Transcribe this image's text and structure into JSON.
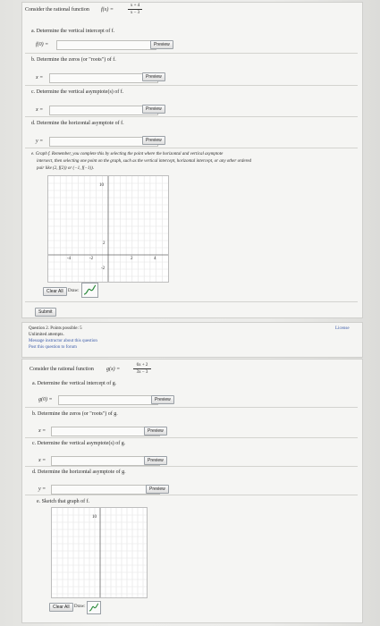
{
  "q1": {
    "intro": "Consider the rational function",
    "func_lhs": "f(x) =",
    "func_num": "x + 4",
    "func_den": "x − 3",
    "a": "a. Determine the vertical intercept of f.",
    "a_label": "f(0) =",
    "b": "b. Determine the zeros (or \"roots\") of f.",
    "b_label": "x =",
    "c": "c. Determine the vertical asymptote(s) of f.",
    "c_label": "x =",
    "d": "d. Determine the horizontal asymptote of f.",
    "d_label": "y =",
    "preview": "Preview",
    "e_line1": "e. Graph f. Remember, you complete this by selecting the point where the horizontal and vertical asymptote",
    "e_line2": "intersect, then selecting one point on the graph, such as the vertical intercept, horizontal intercept, or any other ordered",
    "e_line3": "pair like (2, f(2)) or (−1, f(−1)).",
    "ticks_x": [
      "-4",
      "-2",
      "2",
      "4"
    ],
    "ticks_y": [
      "10",
      "2",
      "-2"
    ],
    "clear_all": "Clear All",
    "draw": "Draw:",
    "submit": "Submit"
  },
  "q2": {
    "header": "Question 2. Points possible: 5",
    "attempts": "Unlimited attempts.",
    "message": "Message instructor about this question",
    "post": "Post this question to forum",
    "license": "License",
    "intro": "Consider the rational function",
    "func_lhs": "g(x) =",
    "func_num": "6x + 2",
    "func_den": "3x − 3",
    "a": "a. Determine the vertical intercept of g.",
    "a_label": "g(0) =",
    "b": "b. Determine the zeros (or \"roots\") of g.",
    "b_label": "x =",
    "c": "c. Determine the vertical asymptote(s) of g.",
    "c_label": "x =",
    "d": "d. Determine the horizontal asymptote of g.",
    "d_label": "y =",
    "preview": "Preview",
    "e": "e. Sketch that graph of f.",
    "ticks_y": [
      "10"
    ],
    "clear_all": "Clear All",
    "draw": "Draw:"
  },
  "colors": {
    "link_blue": "#3a5aa8",
    "panel_bg": "#f5f5f3"
  },
  "icons": {
    "draw_tool": "curve-draw-icon"
  }
}
